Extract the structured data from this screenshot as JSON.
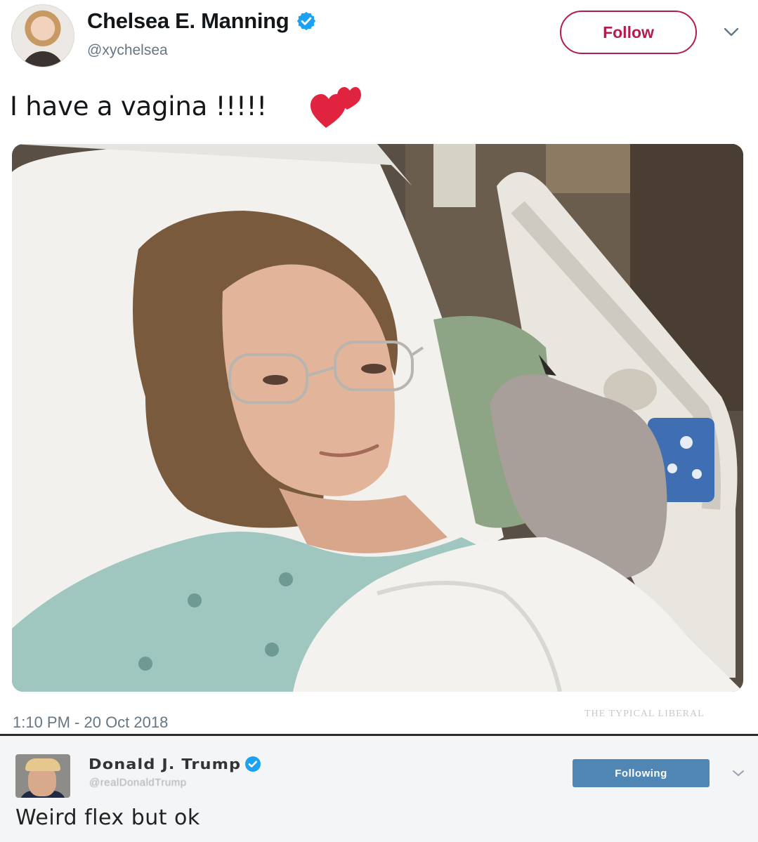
{
  "tweet": {
    "author": {
      "display_name": "Chelsea E. Manning",
      "handle": "@xychelsea",
      "verified": true,
      "avatar_icon": "profile-photo"
    },
    "follow_label": "Follow",
    "text": "I have a vagina !!!!!",
    "emoji_icon": "two-hearts-emoji",
    "timestamp": "1:10 PM - 20 Oct 2018",
    "watermark": "THE TYPICAL LIBERAL",
    "media_icon": "hospital-bed-photo",
    "more_icon": "chevron-down-icon"
  },
  "reply": {
    "author": {
      "display_name": "Donald J. Trump",
      "handle": "@realDonaldTrump",
      "verified": true,
      "avatar_icon": "profile-photo"
    },
    "following_label": "Following",
    "text": "Weird flex but ok",
    "more_icon": "chevron-down-icon"
  },
  "colors": {
    "follow_accent": "#b41c4f",
    "verified_blue": "#1da1f2",
    "following_bg": "#4f86b3",
    "handle_gray": "#657786",
    "heart_red": "#e0243f"
  }
}
